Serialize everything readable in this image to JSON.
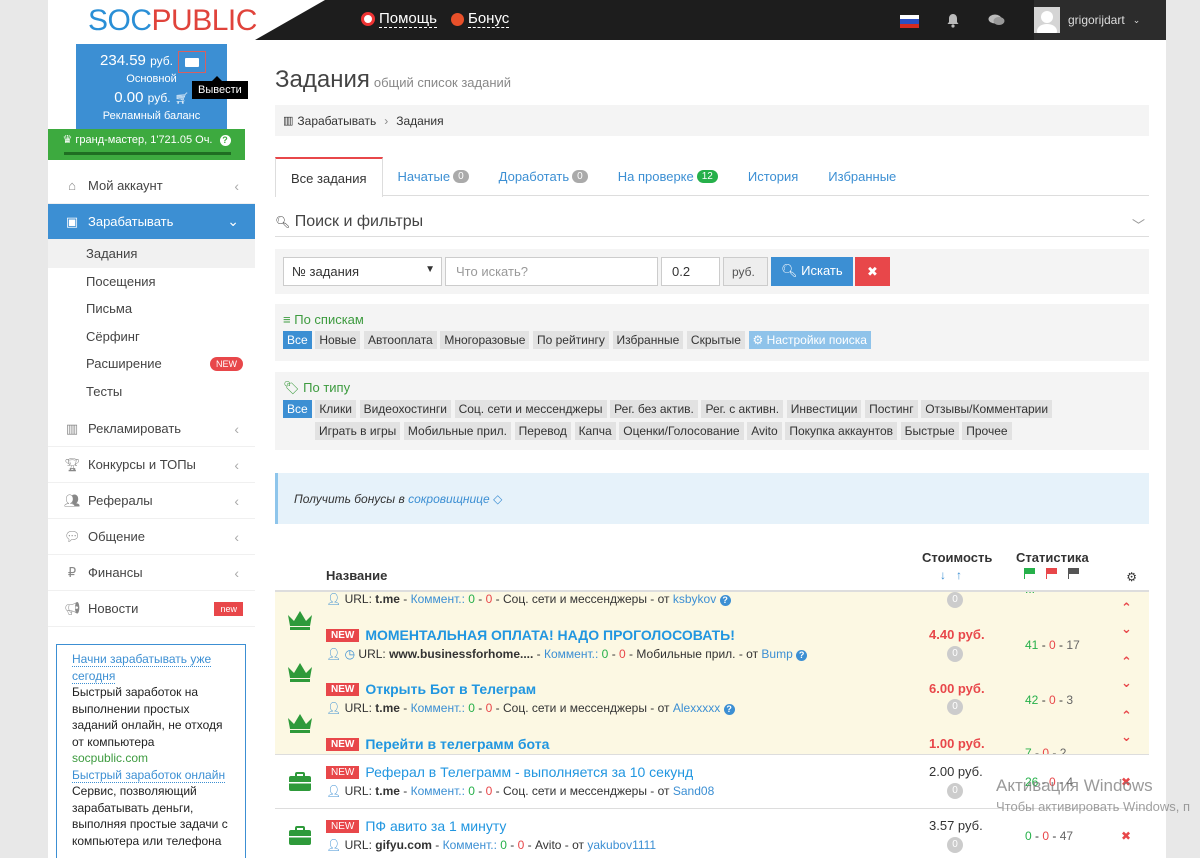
{
  "header": {
    "logo_soc": "SOC",
    "logo_public": "PUBLIC",
    "help": "Помощь",
    "bonus": "Бонус",
    "username": "grigorijdart"
  },
  "balance": {
    "main_value": "234.59",
    "main_currency": "руб.",
    "main_label": "Основной",
    "ad_value": "0.00",
    "ad_currency": "руб.",
    "ad_label": "Рекламный баланс",
    "withdraw_tooltip": "Вывести",
    "rank": "гранд-мастер, 1'721.05 Оч."
  },
  "sidebar": {
    "items": [
      {
        "label": "Мой аккаунт"
      },
      {
        "label": "Зарабатывать"
      },
      {
        "label": "Рекламировать"
      },
      {
        "label": "Конкурсы и ТОПы"
      },
      {
        "label": "Рефералы"
      },
      {
        "label": "Общение"
      },
      {
        "label": "Финансы"
      },
      {
        "label": "Новости",
        "badge": "new"
      }
    ],
    "sub_items": [
      {
        "label": "Задания"
      },
      {
        "label": "Посещения"
      },
      {
        "label": "Письма"
      },
      {
        "label": "Сёрфинг"
      },
      {
        "label": "Расширение",
        "badge": "NEW"
      },
      {
        "label": "Тесты"
      }
    ],
    "promo": {
      "link1": "Начни зарабатывать уже сегодня",
      "text1": "Быстрый заработок на выполнении простых заданий онлайн, не отходя от компьютера",
      "site1": "socpublic.com",
      "link2": "Быстрый заработок онлайн",
      "text2": "Сервис, позволяющий зарабатывать деньги, выполняя простые задачи с компьютера или телефона"
    }
  },
  "main": {
    "title": "Задания",
    "subtitle": "общий список заданий",
    "breadcrumb": [
      "Зарабатывать",
      "Задания"
    ],
    "tabs": [
      {
        "label": "Все задания"
      },
      {
        "label": "Начатые",
        "badge": "0"
      },
      {
        "label": "Доработать",
        "badge": "0"
      },
      {
        "label": "На проверке",
        "badge": "12"
      },
      {
        "label": "История"
      },
      {
        "label": "Избранные"
      }
    ],
    "search_header": "Поиск и фильтры",
    "filter": {
      "select_value": "№ задания",
      "search_placeholder": "Что искать?",
      "price_value": "0.2",
      "currency": "руб.",
      "search_button": "Искать",
      "clear_button": "✖"
    },
    "lists": {
      "title": "По спискам",
      "chips": [
        "Все",
        "Новые",
        "Автооплата",
        "Многоразовые",
        "По рейтингу",
        "Избранные",
        "Скрытые",
        "Настройки поиска"
      ]
    },
    "types": {
      "title": "По типу",
      "chips_row1": [
        "Все",
        "Клики",
        "Видеохостинги",
        "Соц. сети и мессенджеры",
        "Рег. без актив.",
        "Рег. с активн.",
        "Инвестиции",
        "Постинг",
        "Отзывы/Комментарии"
      ],
      "chips_row2": [
        "Играть в игры",
        "Мобильные прил.",
        "Перевод",
        "Капча",
        "Оценки/Голосование",
        "Avito",
        "Покупка аккаунтов",
        "Быстрые",
        "Прочее"
      ]
    },
    "info": {
      "text": "Получить бонусы в",
      "link": "сокровищнице"
    },
    "table": {
      "col_name": "Название",
      "col_cost": "Стоимость",
      "col_stats": "Статистика"
    },
    "tasks": [
      {
        "title": "",
        "url": "t.me",
        "comment_label": "Коммент.:",
        "c1": "0",
        "c2": "0",
        "category": "Соц. сети и мессенджеры",
        "author_prefix": "от",
        "author": "ksbykov",
        "price": "",
        "stat": [
          "",
          "",
          ""
        ],
        "new": false
      },
      {
        "title": "МОМЕНТАЛЬНАЯ ОПЛАТА! НАДО ПРОГОЛОСОВАТЬ!",
        "url": "www.businessforhome....",
        "comment_label": "Коммент.:",
        "c1": "0",
        "c2": "0",
        "category": "Мобильные прил.",
        "author_prefix": "от",
        "author": "Bump",
        "price": "4.40 руб.",
        "stat": [
          "41",
          "0",
          "17"
        ],
        "new": true
      },
      {
        "title": "Открыть Бот в Телеграм",
        "url": "t.me",
        "comment_label": "Коммент.:",
        "c1": "0",
        "c2": "0",
        "category": "Соц. сети и мессенджеры",
        "author_prefix": "от",
        "author": "Alexxxxx",
        "price": "6.00 руб.",
        "stat": [
          "42",
          "0",
          "3"
        ],
        "new": true
      },
      {
        "title": "Перейти в телеграмм бота",
        "price": "1.00 руб.",
        "stat": [
          "7",
          "0",
          "2"
        ],
        "new": true
      },
      {
        "title": "Реферал в Телеграмм - выполняется за 10 секунд",
        "url": "t.me",
        "comment_label": "Коммент.:",
        "c1": "0",
        "c2": "0",
        "category": "Соц. сети и мессенджеры",
        "author_prefix": "от",
        "author": "Sand08",
        "price": "2.00 руб.",
        "stat": [
          "26",
          "0",
          "4"
        ],
        "new": true
      },
      {
        "title": "ПФ авито за 1 минуту",
        "url": "gifyu.com",
        "comment_label": "Коммент.:",
        "c1": "0",
        "c2": "0",
        "category": "Avito",
        "author_prefix": "от",
        "author": "yakubov1111",
        "price": "3.57 руб.",
        "stat": [
          "0",
          "0",
          "47"
        ],
        "new": true
      }
    ],
    "zero_badge": "0",
    "url_label": "URL:"
  },
  "watermark": {
    "line1": "Активация Windows",
    "line2": "Чтобы активировать Windows, п"
  },
  "colors": {
    "accent": "#3c8fd3",
    "danger": "#e8474a",
    "success": "#3daa3f",
    "highlight_row": "#fcf8e3"
  }
}
